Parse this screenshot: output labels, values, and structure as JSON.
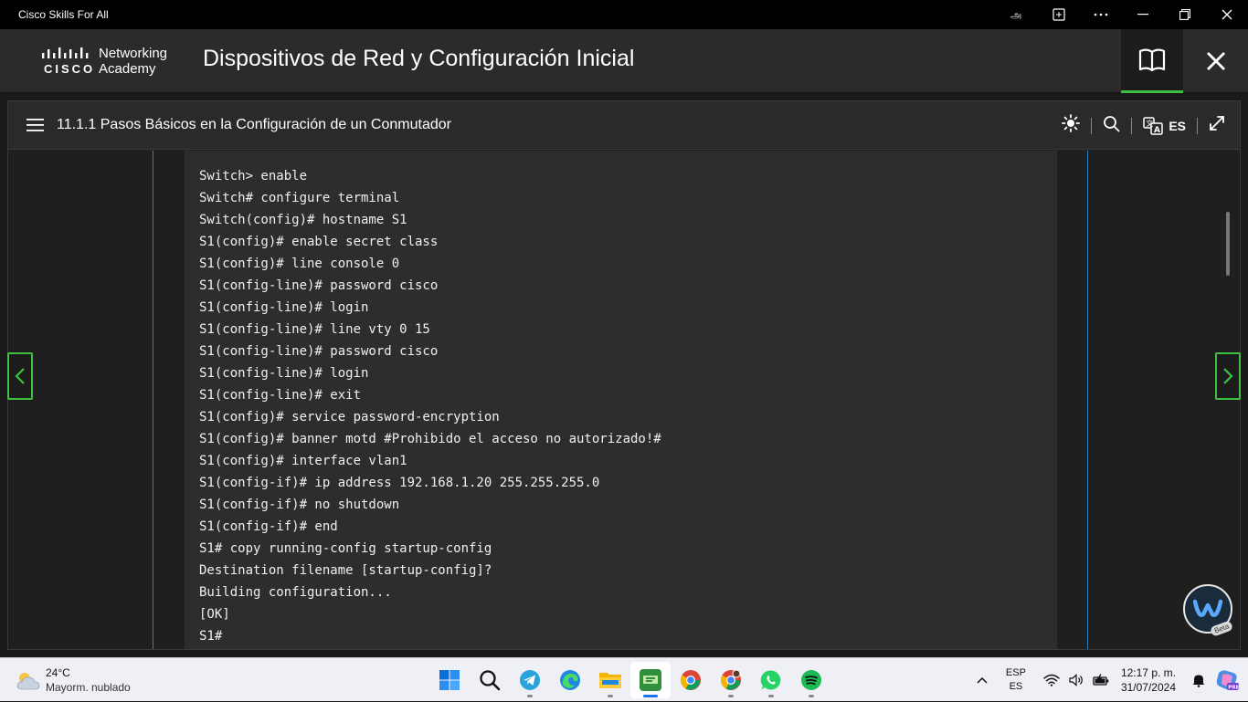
{
  "window": {
    "title": "Cisco Skills For All",
    "controls": [
      "minimize",
      "maximize",
      "close"
    ]
  },
  "header": {
    "logo_brand": "CISCO",
    "logo_line1": "Networking",
    "logo_line2": "Academy",
    "course_title": "Dispositivos de Red y Configuración Inicial"
  },
  "toolbar": {
    "page_title": "11.1.1 Pasos Básicos en la Configuración de un Conmutador",
    "language": "ES"
  },
  "code": {
    "lines": [
      "Switch> enable",
      "Switch# configure terminal",
      "Switch(config)# hostname S1",
      "S1(config)# enable secret class",
      "S1(config)# line console 0",
      "S1(config-line)# password cisco",
      "S1(config-line)# login",
      "S1(config-line)# line vty 0 15",
      "S1(config-line)# password cisco",
      "S1(config-line)# login",
      "S1(config-line)# exit",
      "S1(config)# service password-encryption",
      "S1(config)# banner motd #Prohibido el acceso no autorizado!#",
      "S1(config)# interface vlan1",
      "S1(config-if)# ip address 192.168.1.20 255.255.255.0",
      "S1(config-if)# no shutdown",
      "S1(config-if)# end",
      "S1# copy running-config startup-config",
      "Destination filename [startup-config]?",
      "Building configuration...",
      "[OK]",
      "S1#"
    ]
  },
  "fab": {
    "badge": "Beta"
  },
  "taskbar": {
    "weather_temp": "24°C",
    "weather_cond": "Mayorm. nublado",
    "lang_top": "ESP",
    "lang_bottom": "ES",
    "time": "12:17 p. m.",
    "date": "31/07/2024"
  },
  "colors": {
    "accent_green": "#3ec13e",
    "guide_blue": "#2b7fbf"
  }
}
